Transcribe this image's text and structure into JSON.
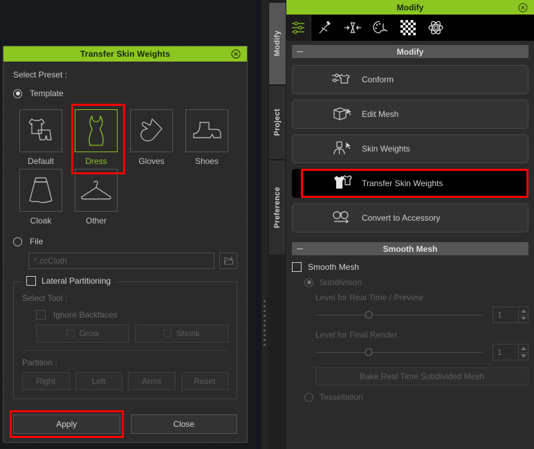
{
  "dialog": {
    "title": "Transfer Skin Weights",
    "close_icon": "close-circle-icon",
    "select_preset_label": "Select Preset :",
    "template_radio_label": "Template",
    "presets": [
      {
        "name": "Default",
        "icon": "tshirt-pants-icon",
        "selected": false
      },
      {
        "name": "Dress",
        "icon": "dress-icon",
        "selected": true
      },
      {
        "name": "Gloves",
        "icon": "glove-icon",
        "selected": false
      },
      {
        "name": "Shoes",
        "icon": "shoe-icon",
        "selected": false
      },
      {
        "name": "Cloak",
        "icon": "cloak-icon",
        "selected": false
      },
      {
        "name": "Other",
        "icon": "hanger-icon",
        "selected": false
      }
    ],
    "file_radio_label": "File",
    "file_placeholder": "*.ccCloth",
    "file_value": "",
    "browse_icon": "folder-open-icon",
    "lateral_partitioning_label": "Lateral Partitioning",
    "select_tool_label": "Select Tool :",
    "ignore_backfaces_label": "Ignore Backfaces",
    "grow_label": "Grow",
    "shrink_label": "Shrink",
    "partition_label": "Partition :",
    "partition_buttons": [
      "Right",
      "Left",
      "Arms",
      "Reset"
    ],
    "apply_label": "Apply",
    "close_label": "Close",
    "highlight_color": "#ff0000",
    "accent_color": "#8cc620"
  },
  "panel": {
    "title": "Modify",
    "close_icon": "close-circle-icon",
    "tabs": [
      {
        "label": "Modify",
        "active": true
      },
      {
        "label": "Project",
        "active": false
      },
      {
        "label": "Preference",
        "active": false
      }
    ],
    "toolbar": [
      {
        "icon": "sliders-icon",
        "active": true
      },
      {
        "icon": "pose-edit-icon",
        "active": false
      },
      {
        "icon": "calibrate-icon",
        "active": false
      },
      {
        "icon": "palette-icon",
        "active": false
      },
      {
        "icon": "checker-icon",
        "active": false
      },
      {
        "icon": "atom-icon",
        "active": false
      }
    ],
    "modify_section": {
      "header": "Modify",
      "buttons": [
        {
          "label": "Conform",
          "icon": "conform-icon",
          "highlighted": false
        },
        {
          "label": "Edit Mesh",
          "icon": "edit-mesh-icon",
          "highlighted": false
        },
        {
          "label": "Skin Weights",
          "icon": "skin-weights-icon",
          "highlighted": false
        },
        {
          "label": "Transfer Skin Weights",
          "icon": "transfer-skin-weights-icon",
          "highlighted": true
        },
        {
          "label": "Convert to Accessory",
          "icon": "convert-accessory-icon",
          "highlighted": false
        }
      ]
    },
    "smooth_section": {
      "header": "Smooth Mesh",
      "smooth_mesh_label": "Smooth Mesh",
      "subdivision_label": "Subdivision",
      "realtime_label": "Level for Real Time / Preview",
      "realtime_value": "1",
      "final_label": "Level for Final Render",
      "final_value": "1",
      "bake_label": "Bake Real Time Subdivided Mesh",
      "tessellation_label": "Tessellation"
    }
  }
}
